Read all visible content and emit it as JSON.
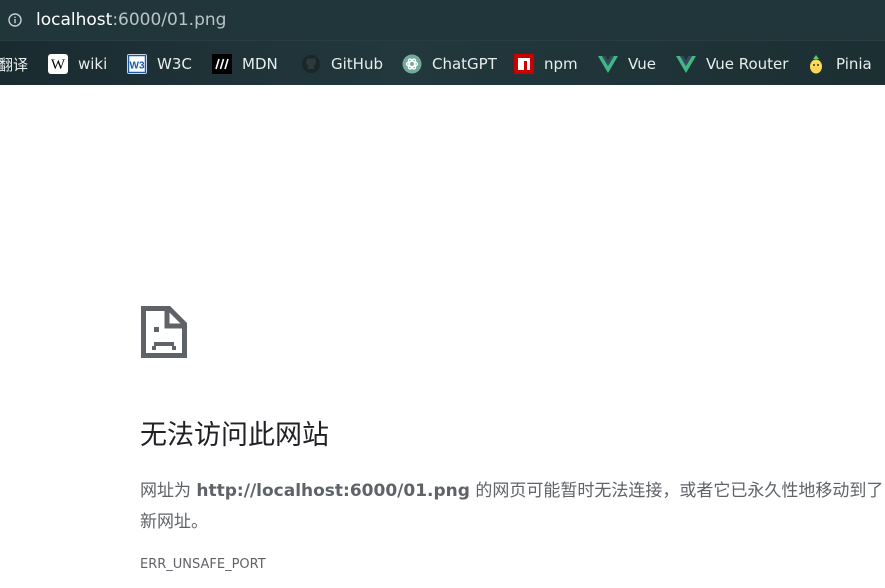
{
  "address_bar": {
    "url_host": "localhost",
    "url_path": ":6000/01.png"
  },
  "bookmarks": [
    {
      "label": "翻译",
      "icon": "translate-icon"
    },
    {
      "label": "wiki",
      "icon": "wikipedia-icon"
    },
    {
      "label": "W3C",
      "icon": "w3c-icon"
    },
    {
      "label": "MDN",
      "icon": "mdn-icon"
    },
    {
      "label": "GitHub",
      "icon": "github-icon"
    },
    {
      "label": "ChatGPT",
      "icon": "chatgpt-icon"
    },
    {
      "label": "npm",
      "icon": "npm-icon"
    },
    {
      "label": "Vue",
      "icon": "vue-icon"
    },
    {
      "label": "Vue Router",
      "icon": "vue-icon"
    },
    {
      "label": "Pinia",
      "icon": "pinia-icon"
    }
  ],
  "error": {
    "title": "无法访问此网站",
    "desc_prefix": "网址为 ",
    "desc_url": "http://localhost:6000/01.png",
    "desc_suffix": " 的网页可能暂时无法连接，或者它已永久性地移动到了新网址。",
    "code": "ERR_UNSAFE_PORT"
  },
  "colors": {
    "chrome_bg": "#20363b",
    "page_bg": "#ffffff",
    "title_text": "#202124",
    "body_text": "#5f6368",
    "vue_green": "#41b883",
    "npm_red": "#cb0000"
  }
}
